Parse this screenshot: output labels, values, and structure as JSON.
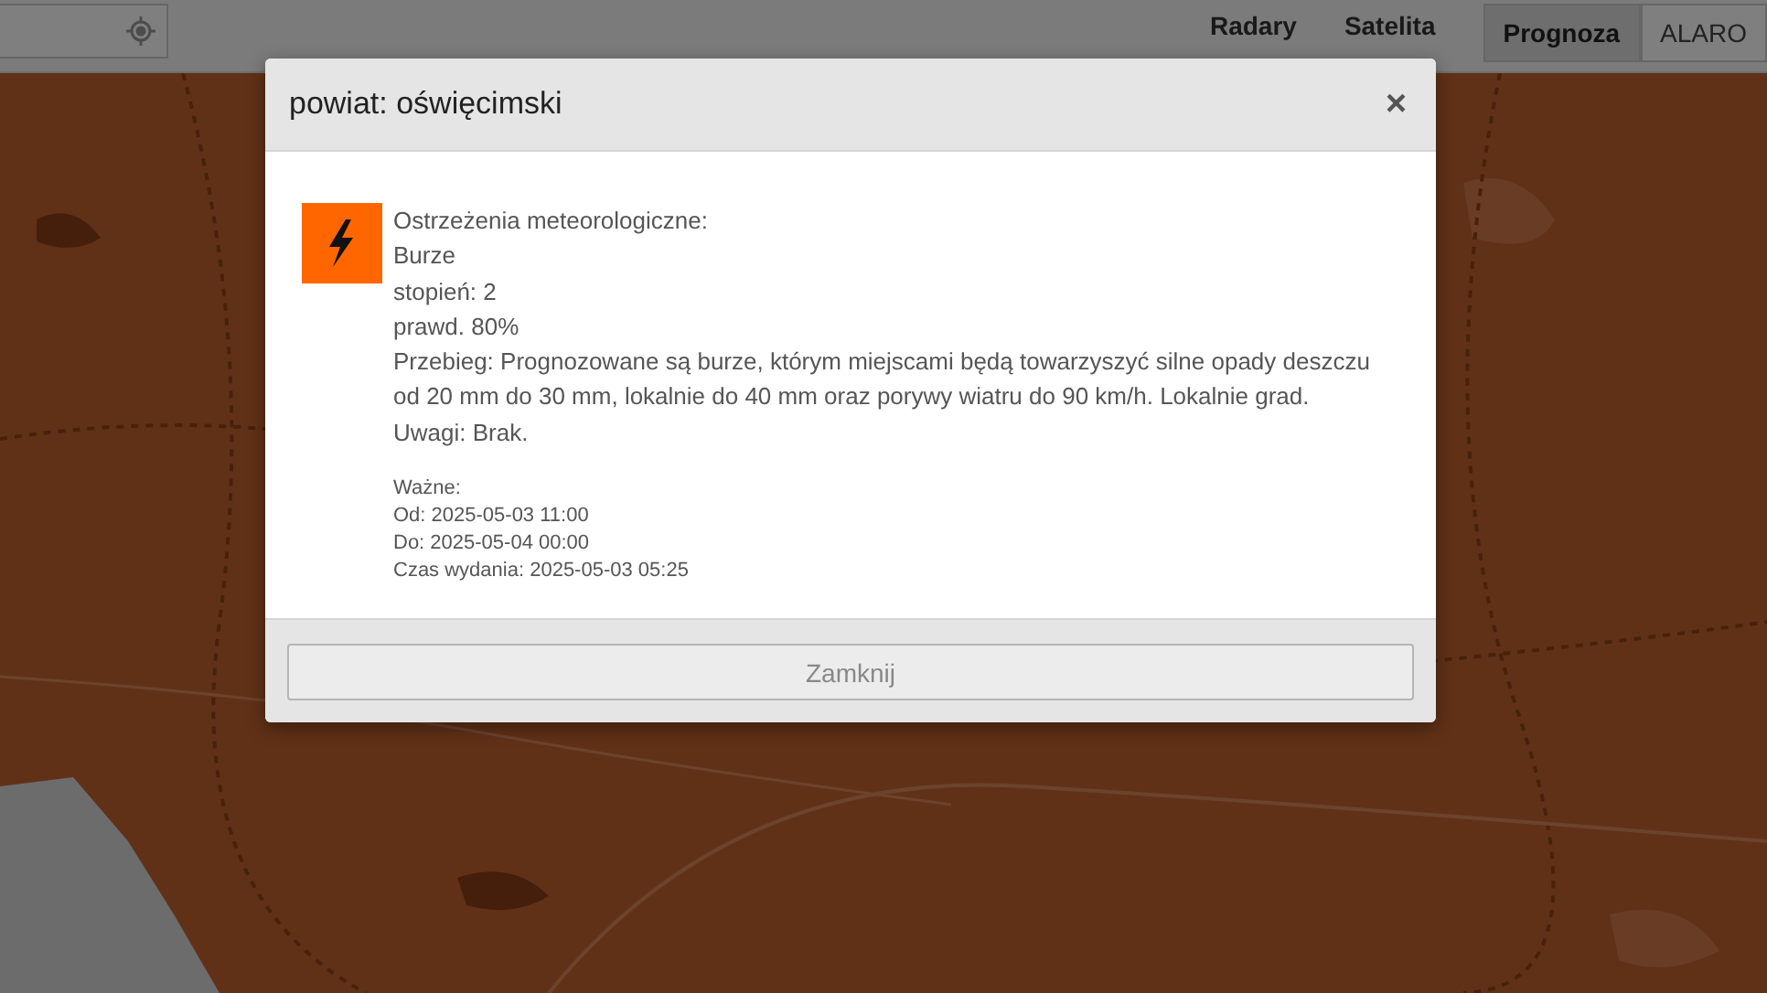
{
  "top_bar": {
    "nav": [
      {
        "label": "Radary",
        "selected": false
      },
      {
        "label": "Satelita",
        "selected": false
      }
    ],
    "modes": [
      {
        "label": "Prognoza",
        "selected": true
      },
      {
        "label": "ALARO",
        "selected": false
      }
    ]
  },
  "dialog": {
    "title": "powiat: oświęcimski",
    "close": "×",
    "lines": [
      "Ostrzeżenia meteorologiczne:",
      "Burze",
      "stopień: 2",
      "prawd. 80%",
      "Przebieg: Prognozowane są burze, którym miejscami będą towarzyszyć silne opady deszczu od 20 mm do 30 mm, lokalnie do 40 mm oraz porywy wiatru do 90 km/h. Lokalnie grad.",
      "Uwagi: Brak."
    ],
    "validity": [
      "Ważne:",
      "Od: 2025-05-03 11:00",
      "Do: 2025-05-04 00:00",
      "Czas wydania: 2025-05-03 05:25"
    ],
    "button": "Zamknij"
  }
}
